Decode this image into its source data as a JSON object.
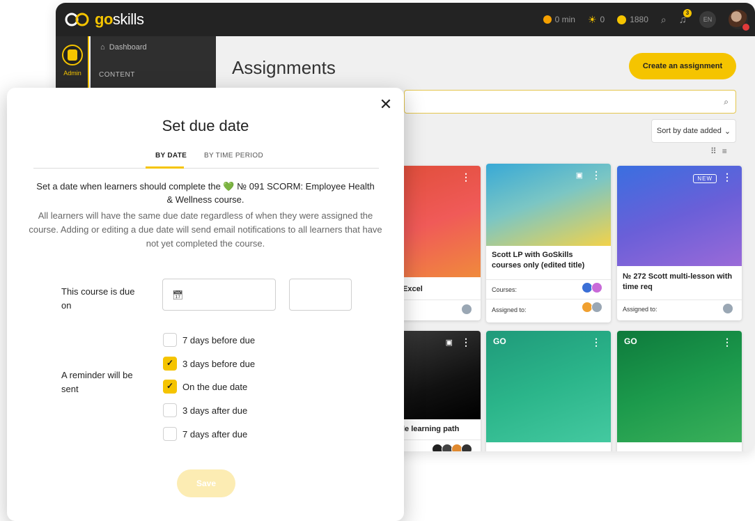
{
  "app": {
    "brand": {
      "go": "go",
      "skills": "skills"
    },
    "stats": {
      "time": "0 min",
      "xp": "0",
      "coins": "1880"
    },
    "notification_count": "3",
    "language": "EN",
    "sidebar": {
      "admin_label": "Admin",
      "dashboard": "Dashboard",
      "content_label": "CONTENT"
    },
    "page_title": "Assignments",
    "create_button": "Create an assignment",
    "sort_label": "Sort by date added",
    "cards": [
      {
        "title": "Scott LP with GoSkills courses only (edited title)",
        "courses_label": "Courses:",
        "assigned_label": "Assigned to:"
      },
      {
        "title": "№ 272 Scott multi-lesson with time req",
        "badge": "NEW",
        "assigned_label": "Assigned to:"
      },
      {
        "title_fragment": "Excel"
      },
      {
        "title_fragment": "le learning path"
      }
    ]
  },
  "modal": {
    "title": "Set due date",
    "tabs": [
      {
        "label": "BY DATE",
        "active": true
      },
      {
        "label": "BY TIME PERIOD",
        "active": false
      }
    ],
    "intro": "Set a date when learners should complete the 💚 № 091 SCORM: Employee Health & Wellness course.",
    "note": "All learners will have the same due date regardless of when they were assigned the course. Adding or editing a due date will send email notifications to all learners that have not yet completed the course.",
    "due_label": "This course is due on",
    "date_value": "",
    "time_value": "",
    "reminder_label": "A reminder will be sent",
    "reminders": [
      {
        "label": "7 days before due",
        "checked": false
      },
      {
        "label": "3 days before due",
        "checked": true
      },
      {
        "label": "On the due date",
        "checked": true
      },
      {
        "label": "3 days after due",
        "checked": false
      },
      {
        "label": "7 days after due",
        "checked": false
      }
    ],
    "save_label": "Save"
  },
  "colors": {
    "accent": "#f5c400",
    "topbar": "#232323",
    "save_disabled": "#fcecb3"
  }
}
